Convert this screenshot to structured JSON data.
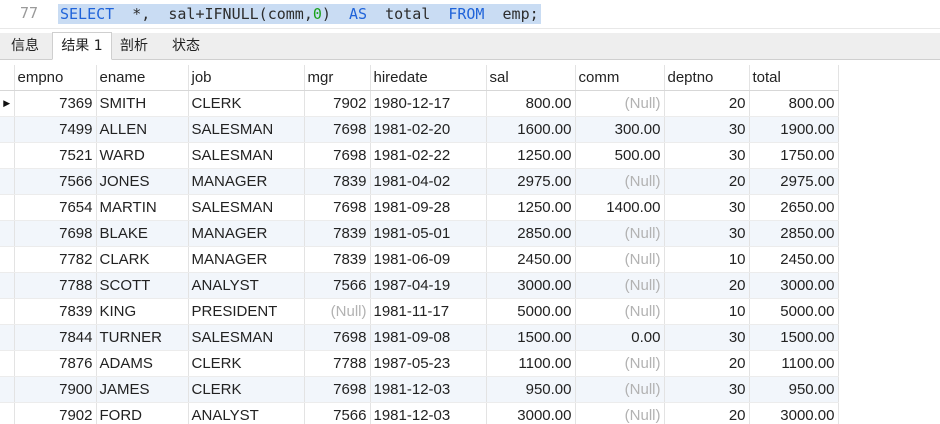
{
  "editor": {
    "line_number": "77",
    "sql_tokens": [
      {
        "t": "SELECT",
        "c": "kw"
      },
      {
        "t": "  *,  ",
        "c": "id"
      },
      {
        "t": "sal+IFNULL(comm,",
        "c": "fn"
      },
      {
        "t": "0",
        "c": "num"
      },
      {
        "t": ")  ",
        "c": "fn"
      },
      {
        "t": "AS",
        "c": "kw"
      },
      {
        "t": "  total  ",
        "c": "id"
      },
      {
        "t": "FROM",
        "c": "kw"
      },
      {
        "t": "  emp;",
        "c": "id"
      }
    ]
  },
  "tabs": {
    "info": "信息",
    "result": "结果 1",
    "profile": "剖析",
    "status": "状态"
  },
  "grid": {
    "columns": [
      "empno",
      "ename",
      "job",
      "mgr",
      "hiredate",
      "sal",
      "comm",
      "deptno",
      "total"
    ],
    "null_label": "(Null)",
    "rows": [
      [
        "7369",
        "SMITH",
        "CLERK",
        "7902",
        "1980-12-17",
        "800.00",
        null,
        "20",
        "800.00"
      ],
      [
        "7499",
        "ALLEN",
        "SALESMAN",
        "7698",
        "1981-02-20",
        "1600.00",
        "300.00",
        "30",
        "1900.00"
      ],
      [
        "7521",
        "WARD",
        "SALESMAN",
        "7698",
        "1981-02-22",
        "1250.00",
        "500.00",
        "30",
        "1750.00"
      ],
      [
        "7566",
        "JONES",
        "MANAGER",
        "7839",
        "1981-04-02",
        "2975.00",
        null,
        "20",
        "2975.00"
      ],
      [
        "7654",
        "MARTIN",
        "SALESMAN",
        "7698",
        "1981-09-28",
        "1250.00",
        "1400.00",
        "30",
        "2650.00"
      ],
      [
        "7698",
        "BLAKE",
        "MANAGER",
        "7839",
        "1981-05-01",
        "2850.00",
        null,
        "30",
        "2850.00"
      ],
      [
        "7782",
        "CLARK",
        "MANAGER",
        "7839",
        "1981-06-09",
        "2450.00",
        null,
        "10",
        "2450.00"
      ],
      [
        "7788",
        "SCOTT",
        "ANALYST",
        "7566",
        "1987-04-19",
        "3000.00",
        null,
        "20",
        "3000.00"
      ],
      [
        "7839",
        "KING",
        "PRESIDENT",
        null,
        "1981-11-17",
        "5000.00",
        null,
        "10",
        "5000.00"
      ],
      [
        "7844",
        "TURNER",
        "SALESMAN",
        "7698",
        "1981-09-08",
        "1500.00",
        "0.00",
        "30",
        "1500.00"
      ],
      [
        "7876",
        "ADAMS",
        "CLERK",
        "7788",
        "1987-05-23",
        "1100.00",
        null,
        "20",
        "1100.00"
      ],
      [
        "7900",
        "JAMES",
        "CLERK",
        "7698",
        "1981-12-03",
        "950.00",
        null,
        "30",
        "950.00"
      ],
      [
        "7902",
        "FORD",
        "ANALYST",
        "7566",
        "1981-12-03",
        "3000.00",
        null,
        "20",
        "3000.00"
      ]
    ],
    "selected_row": 0
  },
  "colors": {
    "keyword": "#1f63d9",
    "number": "#1aa11a",
    "selection": "#c9dcf3",
    "null_text": "#b2b2b2",
    "alt_row": "#f2f6fb"
  }
}
